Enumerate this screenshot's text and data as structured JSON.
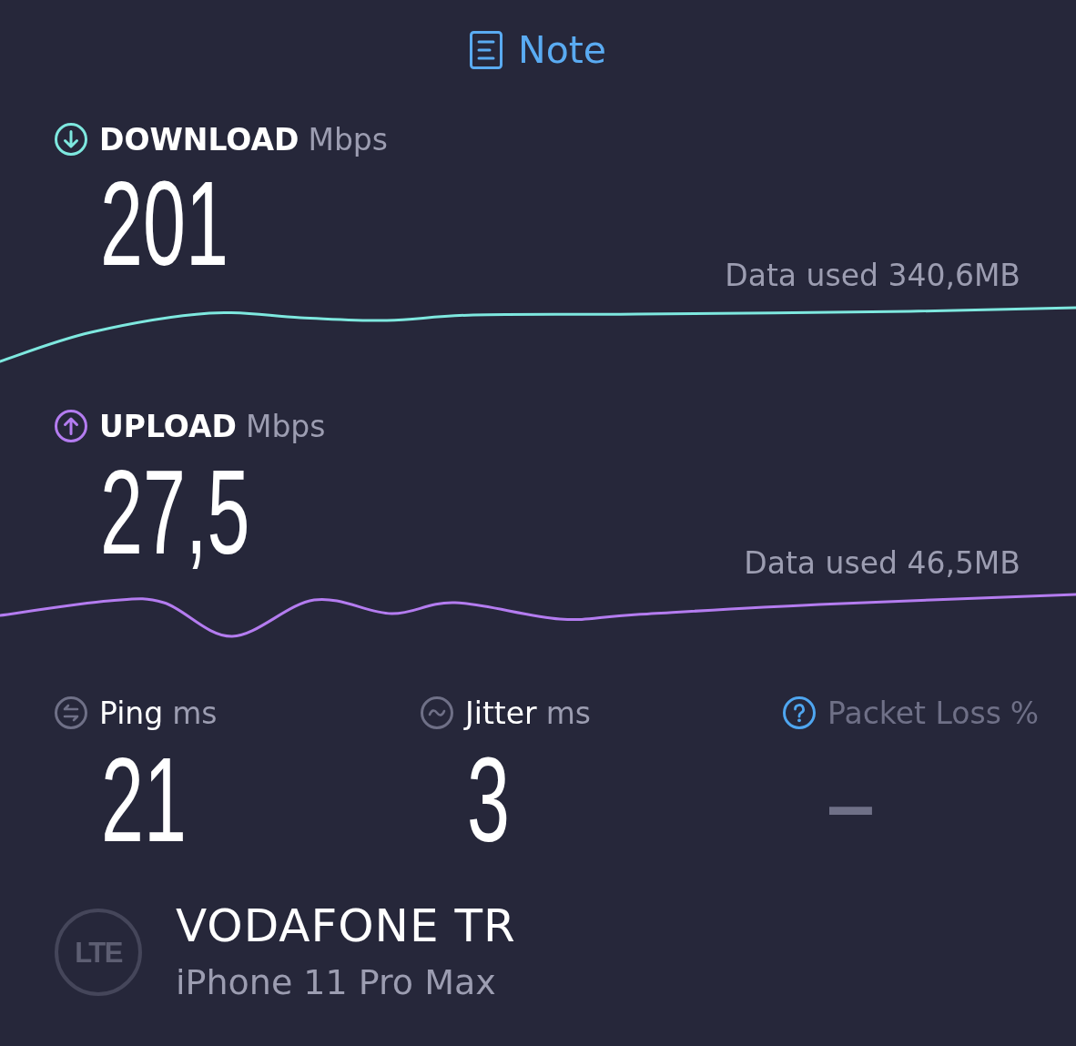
{
  "note_button": {
    "label": "Note"
  },
  "speeds": [
    {
      "kind": "download",
      "label": "DOWNLOAD",
      "unit": "Mbps",
      "value": "201",
      "data_used": "Data used 340,6MB"
    },
    {
      "kind": "upload",
      "label": "UPLOAD",
      "unit": "Mbps",
      "value": "27,5",
      "data_used": "Data used 46,5MB"
    }
  ],
  "stats": [
    {
      "kind": "ping",
      "label": "Ping",
      "unit": "ms",
      "value": "21",
      "disabled": false
    },
    {
      "kind": "jitter",
      "label": "Jitter",
      "unit": "ms",
      "value": "3",
      "disabled": false
    },
    {
      "kind": "packet_loss",
      "label": "Packet Loss",
      "unit": "%",
      "value": "–",
      "disabled": true
    }
  ],
  "connection": {
    "network_type": "LTE",
    "carrier": "VODAFONE TR",
    "device": "iPhone 11 Pro Max"
  }
}
